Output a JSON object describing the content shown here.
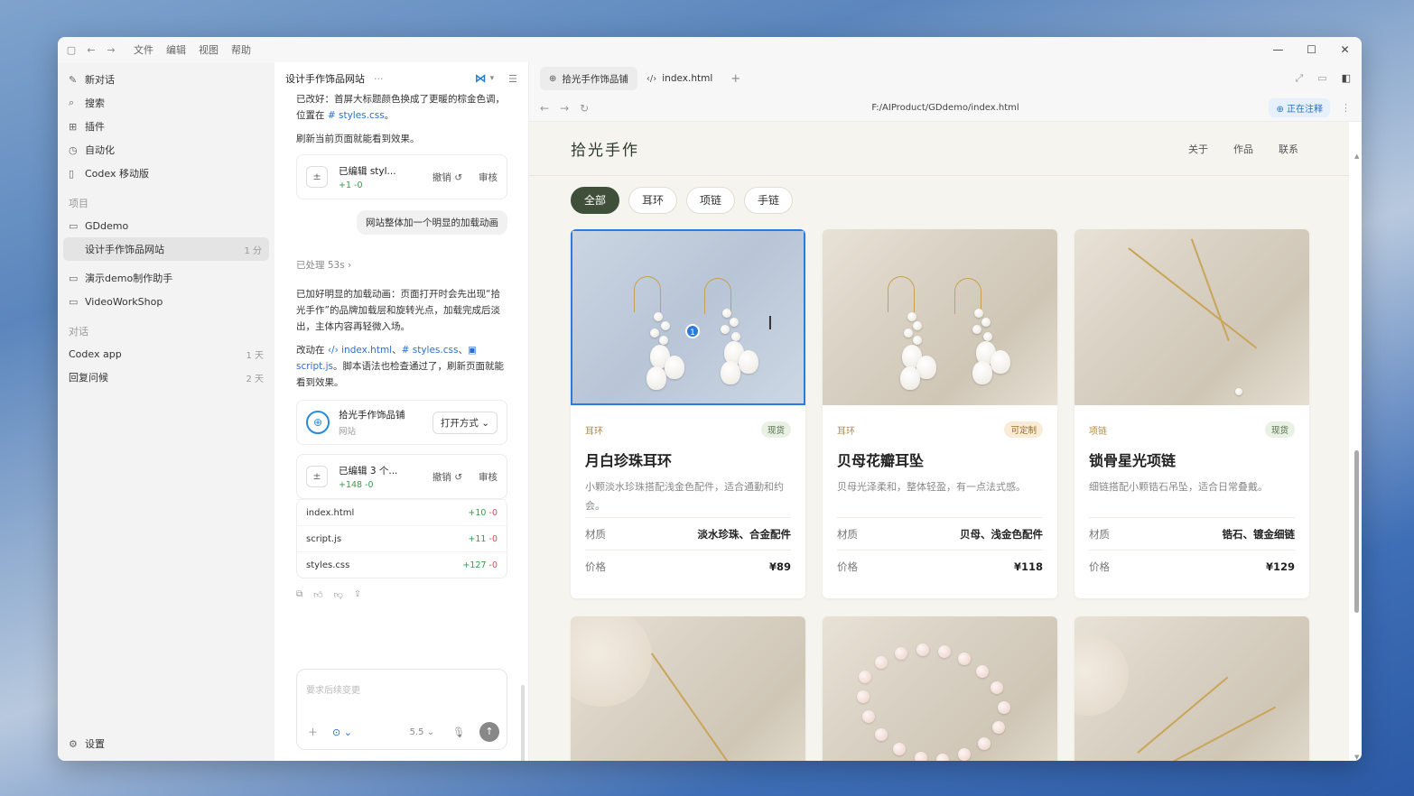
{
  "titlebar": {
    "menus": [
      "文件",
      "编辑",
      "视图",
      "帮助"
    ]
  },
  "sidebar": {
    "top_items": [
      {
        "label": "新对话",
        "icon": "new-chat-icon"
      },
      {
        "label": "搜索",
        "icon": "search-icon"
      },
      {
        "label": "插件",
        "icon": "plugin-icon"
      },
      {
        "label": "自动化",
        "icon": "automation-icon"
      },
      {
        "label": "Codex 移动版",
        "icon": "mobile-icon"
      }
    ],
    "projects_title": "项目",
    "projects": [
      {
        "label": "GDdemo",
        "meta": ""
      },
      {
        "label": "设计手作饰品网站",
        "meta": "1 分"
      },
      {
        "label": "演示demo制作助手",
        "meta": ""
      },
      {
        "label": "VideoWorkShop",
        "meta": ""
      }
    ],
    "chats_title": "对话",
    "chats": [
      {
        "label": "Codex app",
        "meta": "1 天"
      },
      {
        "label": "回复问候",
        "meta": "2 天"
      }
    ],
    "settings_label": "设置"
  },
  "chat": {
    "title": "设计手作饰品网站",
    "p1_a": "已改好：首屏大标题颜色换成了更暖的棕金色调，位置在 ",
    "p1_link": "# styles.css",
    "p1_b": "。",
    "p2": "刷新当前页面就能看到效果。",
    "edit1": {
      "title": "已编辑 styl...",
      "diff": "+1 -0",
      "undo": "撤销 ↺",
      "review": "审核"
    },
    "user_msg": "网站整体加一个明显的加载动画",
    "processed": "已处理 53s ›",
    "p3": "已加好明显的加载动画：页面打开时会先出现“拾光手作”的品牌加载层和旋转光点，加载完成后淡出，主体内容再轻微入场。",
    "p4_a": "改动在 ",
    "p4_l1": "‹/› index.html",
    "p4_sep1": "、",
    "p4_l2": "# styles.css",
    "p4_sep2": "、",
    "p4_l3": "▣ script.js",
    "p4_b": "。脚本语法也检查通过了，刷新页面就能看到效果。",
    "web_card": {
      "title": "拾光手作饰品铺",
      "sub": "网站",
      "open": "打开方式 ⌄"
    },
    "edit2": {
      "title": "已编辑 3 个...",
      "diff": "+148 -0",
      "undo": "撤销 ↺",
      "review": "审核"
    },
    "files": [
      {
        "name": "index.html",
        "add": "+10",
        "del": "-0"
      },
      {
        "name": "script.js",
        "add": "+11",
        "del": "-0"
      },
      {
        "name": "styles.css",
        "add": "+127",
        "del": "-0"
      }
    ],
    "composer": {
      "placeholder": "要求后续变更",
      "version": "5.5 ⌄"
    }
  },
  "browser": {
    "tabs": [
      {
        "label": "拾光手作饰品铺",
        "icon": "globe-icon"
      },
      {
        "label": "index.html",
        "icon": "code-icon"
      }
    ],
    "url": "F:/AIProduct/GDdemo/index.html",
    "annotate_label": "⊕ 正在注释"
  },
  "site": {
    "brand": "拾光手作",
    "nav": [
      "关于",
      "作品",
      "联系"
    ],
    "filters": [
      "全部",
      "耳环",
      "项链",
      "手链"
    ],
    "active_filter": 0,
    "spec_labels": {
      "material": "材质",
      "price": "价格"
    },
    "products": [
      {
        "category": "耳环",
        "badge": "现货",
        "name": "月白珍珠耳环",
        "desc": "小颗淡水珍珠搭配浅金色配件，适合通勤和约会。",
        "material": "淡水珍珠、合金配件",
        "price": "¥89"
      },
      {
        "category": "耳环",
        "badge": "可定制",
        "name": "贝母花瓣耳坠",
        "desc": "贝母光泽柔和，整体轻盈，有一点法式感。",
        "material": "贝母、浅金色配件",
        "price": "¥118"
      },
      {
        "category": "项链",
        "badge": "现货",
        "name": "锁骨星光项链",
        "desc": "细链搭配小颗锆石吊坠，适合日常叠戴。",
        "material": "锆石、镀金细链",
        "price": "¥129"
      }
    ],
    "selection_marker": "1"
  }
}
